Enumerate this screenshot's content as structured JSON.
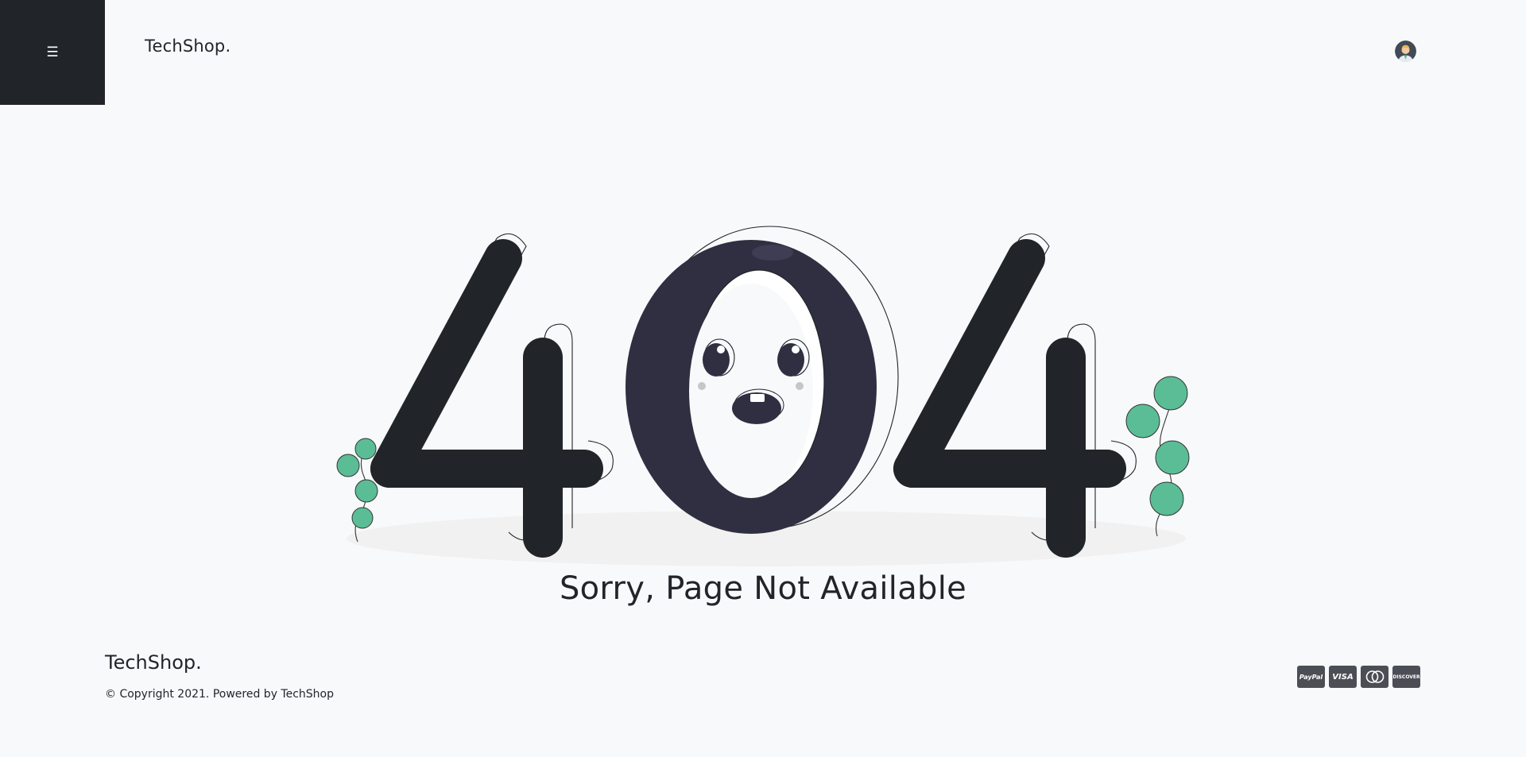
{
  "header": {
    "menu_icon": "☰",
    "brand": "TechShop."
  },
  "main": {
    "error_code": "404",
    "message": "Sorry, Page Not Available"
  },
  "footer": {
    "brand": "TechShop.",
    "copyright": "© Copyright 2021. Powered by TechShop",
    "payments": [
      {
        "name": "paypal",
        "label": "PayPal"
      },
      {
        "name": "visa",
        "label": "VISA"
      },
      {
        "name": "mastercard",
        "label": ""
      },
      {
        "name": "discover",
        "label": "DISCOVER"
      }
    ]
  },
  "colors": {
    "dark": "#212529",
    "zero": "#302f42",
    "leaf": "#5bbd96",
    "background": "#f8f9fb"
  }
}
